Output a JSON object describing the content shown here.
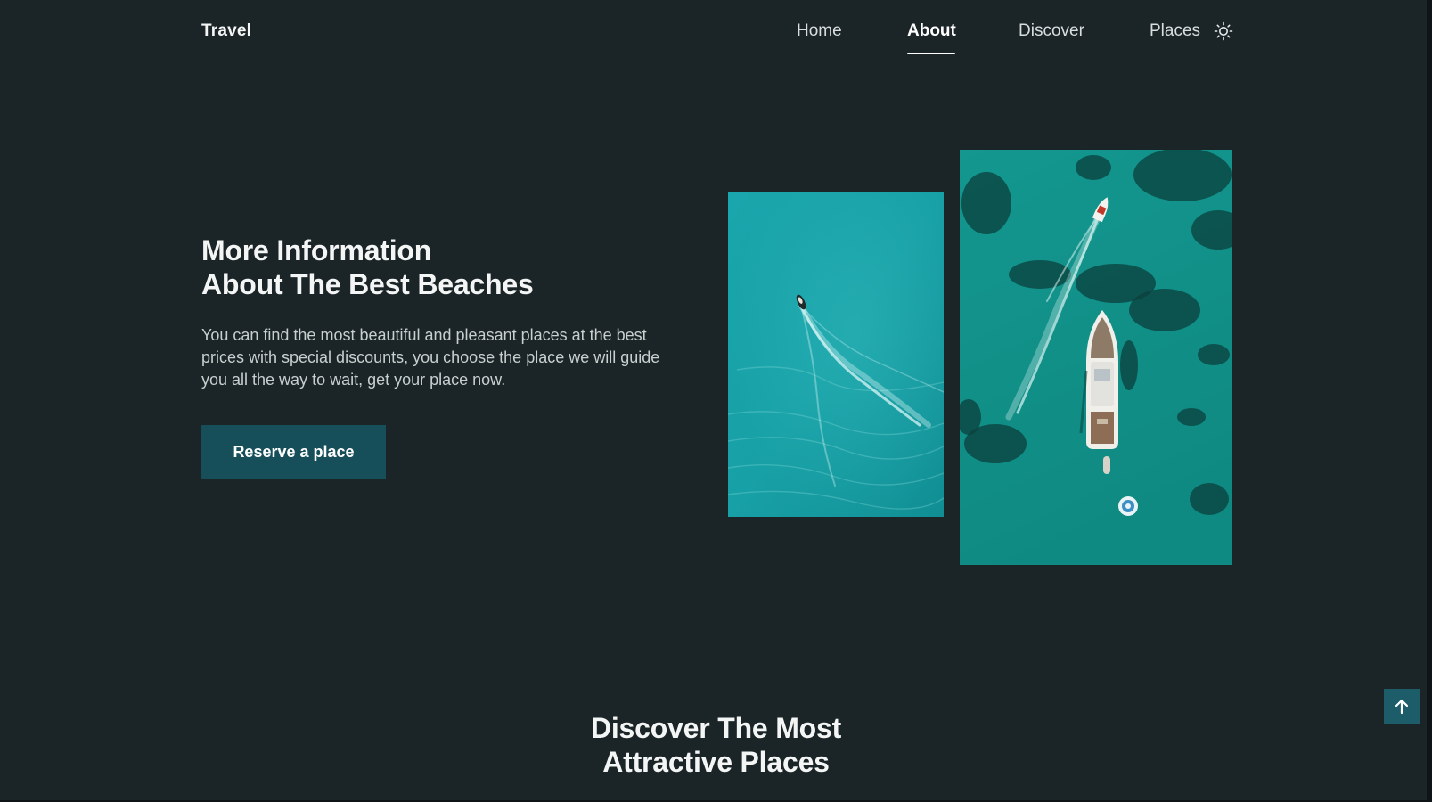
{
  "header": {
    "logo": "Travel",
    "nav": [
      {
        "label": "Home",
        "active": false
      },
      {
        "label": "About",
        "active": true
      },
      {
        "label": "Discover",
        "active": false
      },
      {
        "label": "Places",
        "active": false
      }
    ],
    "theme_toggle_icon": "sun-icon"
  },
  "hero": {
    "title_line1": "More Information",
    "title_line2": "About The Best Beaches",
    "description": "You can find the most beautiful and pleasant places at the best prices with special discounts, you choose the place we will guide you all the way to wait, get your place now.",
    "button_label": "Reserve a place",
    "images": [
      {
        "name": "aerial-boat-turquoise-water"
      },
      {
        "name": "aerial-yacht-and-speedboat"
      }
    ]
  },
  "discover": {
    "title_line1": "Discover The Most",
    "title_line2": "Attractive Places"
  },
  "scroll_up_icon": "arrow-up-icon",
  "colors": {
    "background": "#1b2427",
    "button": "#164e5a",
    "scroll_button": "#1d5c69",
    "water_light": "#17a3a8",
    "water_dark": "#0e8a84"
  }
}
